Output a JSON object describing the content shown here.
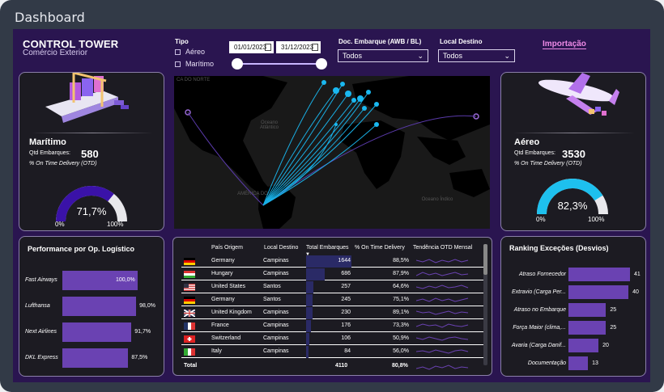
{
  "window": {
    "title": "Dashboard"
  },
  "header": {
    "title": "CONTROL TOWER",
    "subtitle": "Comércio Exterior",
    "tipo_label": "Tipo",
    "tipo_options": [
      "Aéreo",
      "Marítimo"
    ],
    "date_from": "01/01/2023",
    "date_to": "31/12/2023",
    "doc_label": "Doc. Embarque (AWB / BL)",
    "doc_value": "Todos",
    "destino_label": "Local Destino",
    "destino_value": "Todos",
    "importacao_link": "Importação"
  },
  "maritimo": {
    "name": "Marítimo",
    "qtd_label": "Qtd Embarques:",
    "qtd_value": "580",
    "otd_label": "% On Time Delivery (OTD)",
    "gauge_value": "71,7%",
    "gauge_fraction": 0.717,
    "gauge_min": "0%",
    "gauge_max": "100%"
  },
  "aereo": {
    "name": "Aéreo",
    "qtd_label": "Qtd Embarques:",
    "qtd_value": "3530",
    "otd_label": "% On Time Delivery (OTD)",
    "gauge_value": "82,3%",
    "gauge_fraction": 0.823,
    "gauge_min": "0%",
    "gauge_max": "100%"
  },
  "performance": {
    "title": "Performance por Op. Logístico",
    "items": [
      {
        "label": "Fast Airways",
        "value_text": "100,0%",
        "value": 100.0
      },
      {
        "label": "Lufthansa",
        "value_text": "98,0%",
        "value": 98.0
      },
      {
        "label": "Next Airlines",
        "value_text": "91,7%",
        "value": 91.7
      },
      {
        "label": "DKL Express",
        "value_text": "87,5%",
        "value": 87.5
      }
    ]
  },
  "ranking": {
    "title": "Ranking Exceções (Desvios)",
    "items": [
      {
        "label": "Atraso Fornecedor",
        "value": 41
      },
      {
        "label": "Extravio (Carga Per...",
        "value": 40
      },
      {
        "label": "Atraso no Embarque",
        "value": 25
      },
      {
        "label": "Força Maior (clima,...",
        "value": 25
      },
      {
        "label": "Avaria (Carga Danif...",
        "value": 20
      },
      {
        "label": "Documentação",
        "value": 13
      }
    ]
  },
  "map": {
    "labels": [
      "CA  DO NORTE",
      "Oceano Atlântico",
      "AMÉRICA DO",
      "Oceano Índico"
    ]
  },
  "table": {
    "headers": [
      "País Origem",
      "Local Destino",
      "Total Embarques",
      "% On Time Delivery",
      "Tendência OTD Mensal"
    ],
    "rows": [
      {
        "flag": "germany",
        "pais": "Germany",
        "destino": "Campinas",
        "total": "1644",
        "total_num": 1644,
        "otd": "88,5%"
      },
      {
        "flag": "hungary",
        "pais": "Hungary",
        "destino": "Campinas",
        "total": "686",
        "total_num": 686,
        "otd": "87,9%"
      },
      {
        "flag": "usa",
        "pais": "United States",
        "destino": "Santos",
        "total": "257",
        "total_num": 257,
        "otd": "64,6%"
      },
      {
        "flag": "germany",
        "pais": "Germany",
        "destino": "Santos",
        "total": "245",
        "total_num": 245,
        "otd": "75,1%"
      },
      {
        "flag": "uk",
        "pais": "United Kingdom",
        "destino": "Campinas",
        "total": "230",
        "total_num": 230,
        "otd": "89,1%"
      },
      {
        "flag": "france",
        "pais": "France",
        "destino": "Campinas",
        "total": "176",
        "total_num": 176,
        "otd": "73,3%"
      },
      {
        "flag": "switzerland",
        "pais": "Switzerland",
        "destino": "Campinas",
        "total": "106",
        "total_num": 106,
        "otd": "50,9%"
      },
      {
        "flag": "italy",
        "pais": "Italy",
        "destino": "Campinas",
        "total": "84",
        "total_num": 84,
        "otd": "56,0%"
      }
    ],
    "total_label": "Total",
    "total_value": "4110",
    "total_otd": "80,8%"
  },
  "colors": {
    "accent": "#6a42b2",
    "gauge_maritimo": "#3a12a8",
    "gauge_aereo": "#1ec0ee",
    "link": "#ee8ae6"
  }
}
